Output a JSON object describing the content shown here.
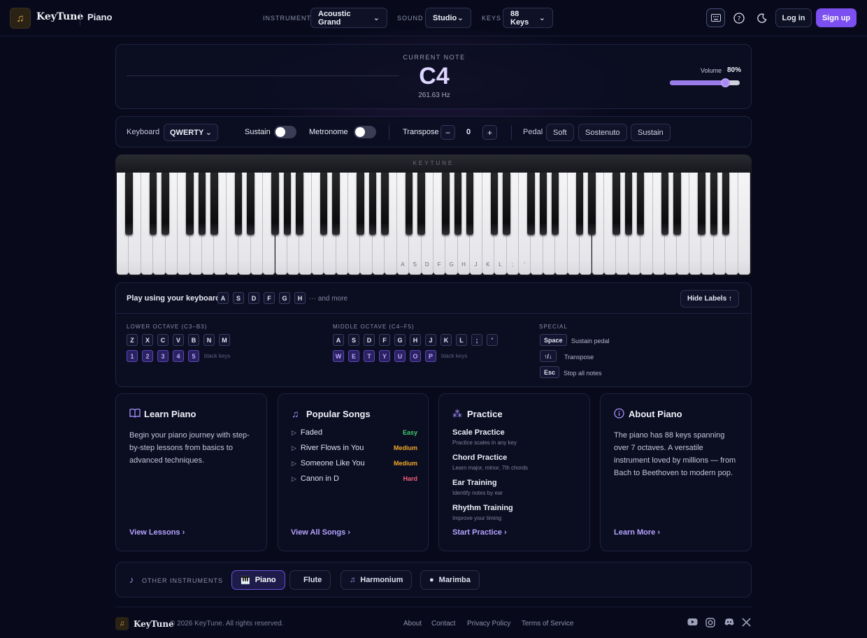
{
  "header": {
    "brand": "KeyTune",
    "page": "Piano",
    "instrument_label": "INSTRUMENT",
    "instrument_value": "Acoustic Grand",
    "sound_label": "SOUND",
    "sound_value": "Studio",
    "keys_label": "KEYS",
    "keys_value": "88 Keys",
    "login": "Log in",
    "signup": "Sign up"
  },
  "note": {
    "label": "CURRENT NOTE",
    "value": "C4",
    "frequency": "261.63 Hz",
    "volume_label": "Volume",
    "volume_value": "80%",
    "volume_fraction": 0.8
  },
  "controls": {
    "keyboard_label": "Keyboard",
    "keyboard_value": "QWERTY",
    "sustain_label": "Sustain",
    "metronome_label": "Metronome",
    "transpose_label": "Transpose",
    "transpose_minus": "−",
    "transpose_value": "0",
    "transpose_plus": "+",
    "pedal_label": "Pedal",
    "pedals": [
      "Soft",
      "Sostenuto",
      "Sustain"
    ]
  },
  "piano": {
    "brand": "KEYTUNE",
    "key_labels": [
      "A",
      "S",
      "D",
      "F",
      "G",
      "H",
      "J",
      "K",
      "L",
      ";",
      "'"
    ]
  },
  "help": {
    "title": "Play using your keyboard",
    "preview_keys": [
      "A",
      "S",
      "D",
      "F",
      "G",
      "H"
    ],
    "more": "··· and more",
    "hide_button": "Hide Labels ↑",
    "lower_label": "LOWER OCTAVE (C3–B3)",
    "lower_white": [
      "Z",
      "X",
      "C",
      "V",
      "B",
      "N",
      "M"
    ],
    "lower_black": [
      "1",
      "2",
      "3",
      "4",
      "5"
    ],
    "middle_label": "MIDDLE OCTAVE (C4–F5)",
    "middle_white": [
      "A",
      "S",
      "D",
      "F",
      "G",
      "H",
      "J",
      "K",
      "L",
      ";",
      "'"
    ],
    "middle_black": [
      "W",
      "E",
      "T",
      "Y",
      "U",
      "O",
      "P"
    ],
    "black_keys_note": "black keys",
    "special_label": "SPECIAL",
    "special": [
      {
        "key": "Space",
        "desc": "Sustain pedal"
      },
      {
        "key": "↑/↓",
        "desc": "Transpose"
      },
      {
        "key": "Esc",
        "desc": "Stop all notes"
      }
    ]
  },
  "cards": {
    "learn": {
      "title": "Learn Piano",
      "body": "Begin your piano journey with step-by-step lessons from basics to advanced techniques.",
      "link": "View Lessons ›"
    },
    "songs": {
      "title": "Popular Songs",
      "items": [
        {
          "name": "Faded",
          "difficulty": "Easy"
        },
        {
          "name": "River Flows in You",
          "difficulty": "Medium"
        },
        {
          "name": "Someone Like You",
          "difficulty": "Medium"
        },
        {
          "name": "Canon in D",
          "difficulty": "Hard"
        }
      ],
      "link": "View All Songs ›"
    },
    "practice": {
      "title": "Practice",
      "items": [
        {
          "title": "Scale Practice",
          "sub": "Practice scales in any key"
        },
        {
          "title": "Chord Practice",
          "sub": "Learn major, minor, 7th chords"
        },
        {
          "title": "Ear Training",
          "sub": "Identify notes by ear"
        },
        {
          "title": "Rhythm Training",
          "sub": "Improve your timing"
        }
      ],
      "link": "Start Practice ›"
    },
    "about": {
      "title": "About Piano",
      "body": "The piano has 88 keys spanning over 7 octaves. A versatile instrument loved by millions — from Bach to Beethoven to modern pop.",
      "link": "Learn More ›"
    }
  },
  "instruments": {
    "label": "OTHER INSTRUMENTS",
    "items": [
      "Piano",
      "Flute",
      "Harmonium",
      "Marimba"
    ]
  },
  "footer": {
    "brand": "KeyTune",
    "copyright": "© 2026 KeyTune. All rights reserved.",
    "links": [
      "About",
      "Contact",
      "Privacy Policy",
      "Terms of Service"
    ]
  },
  "colors": {
    "accent": "#7c4ff0",
    "easy": "#3ecf6e",
    "medium": "#f0a92a",
    "hard": "#f25f7a"
  }
}
